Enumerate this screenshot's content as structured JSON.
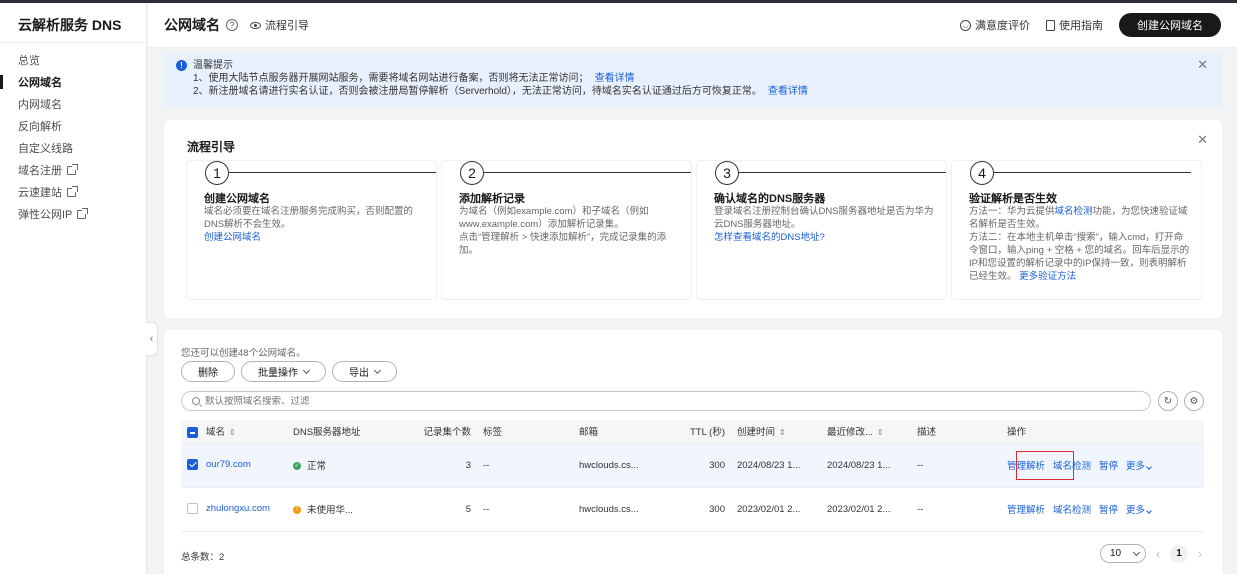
{
  "sidebar": {
    "title": "云解析服务 DNS",
    "items": [
      {
        "label": "总览",
        "active": false,
        "external": false
      },
      {
        "label": "公网域名",
        "active": true,
        "external": false
      },
      {
        "label": "内网域名",
        "active": false,
        "external": false
      },
      {
        "label": "反向解析",
        "active": false,
        "external": false
      },
      {
        "label": "自定义线路",
        "active": false,
        "external": false
      },
      {
        "label": "域名注册",
        "active": false,
        "external": true
      },
      {
        "label": "云速建站",
        "active": false,
        "external": true
      },
      {
        "label": "弹性公网IP",
        "active": false,
        "external": true
      }
    ]
  },
  "header": {
    "title": "公网域名",
    "guide_link": "流程引导",
    "satisfaction": "满意度评价",
    "manual": "使用指南",
    "create_button": "创建公网域名"
  },
  "notice": {
    "title": "温馨提示",
    "line1": "1、使用大陆节点服务器开展网站服务，需要将域名网站进行备案，否则将无法正常访问；",
    "line1_link": "查看详情",
    "line2": "2、新注册域名请进行实名认证，否则会被注册局暂停解析（Serverhold），无法正常访问，待域名实名认证通过后方可恢复正常。",
    "line2_link": "查看详情"
  },
  "guide": {
    "title": "流程引导",
    "steps": [
      {
        "num": "1",
        "title": "创建公网域名",
        "desc": "域名必须要在域名注册服务完成购买，否则配置的DNS解析不会生效。",
        "link": "创建公网域名"
      },
      {
        "num": "2",
        "title": "添加解析记录",
        "desc": "为域名（例如example.com）和子域名（例如www.example.com）添加解析记录集。",
        "desc2": "点击“管理解析 > 快速添加解析”，完成记录集的添加。"
      },
      {
        "num": "3",
        "title": "确认域名的DNS服务器",
        "desc": "登录域名注册控制台确认DNS服务器地址是否为华为云DNS服务器地址。",
        "link": "怎样查看域名的DNS地址?"
      },
      {
        "num": "4",
        "title": "验证解析是否生效",
        "desc_a": "方法一：华为云提供",
        "desc_a_link": "域名检测",
        "desc_a_tail": "功能，为您快速验证域名解析是否生效。",
        "desc_b": "方法二：在本地主机单击“搜索”，输入cmd，打开命令窗口，输入ping + 空格 + 您的域名。回车后显示的IP和您设置的解析记录中的IP保持一致，则表明解析已经生效。",
        "link": "更多验证方法"
      }
    ]
  },
  "table_section": {
    "quota": "您还可以创建48个公网域名。",
    "delete_btn": "删除",
    "batch_btn": "批量操作",
    "export_btn": "导出",
    "search_placeholder": "默认按照域名搜索、过滤",
    "columns": [
      "域名",
      "DNS服务器地址",
      "记录集个数",
      "标签",
      "邮箱",
      "TTL (秒)",
      "创建时间",
      "最近修改...",
      "描述",
      "操作"
    ],
    "rows": [
      {
        "domain": "our79.com",
        "status": "正常",
        "status_type": "ok",
        "records": "3",
        "tags": "--",
        "email": "hwclouds.cs...",
        "ttl": "300",
        "created": "2024/08/23 1...",
        "modified": "2024/08/23 1...",
        "desc": "--",
        "selected": true
      },
      {
        "domain": "zhulongxu.com",
        "status": "未使用华...",
        "status_type": "warn",
        "records": "5",
        "tags": "--",
        "email": "hwclouds.cs...",
        "ttl": "300",
        "created": "2023/02/01 2...",
        "modified": "2023/02/01 2...",
        "desc": "--",
        "selected": false
      }
    ],
    "ops": {
      "manage": "管理解析",
      "check": "域名检测",
      "pause": "暂停",
      "more": "更多"
    },
    "total": "总条数：2",
    "page_size": "10",
    "current_page": "1"
  },
  "colors": {
    "accent": "#1a5fd7",
    "dark_button": "#191919",
    "ok": "#3ba55c",
    "warn": "#f29b11",
    "highlight": "#e02a2a"
  }
}
